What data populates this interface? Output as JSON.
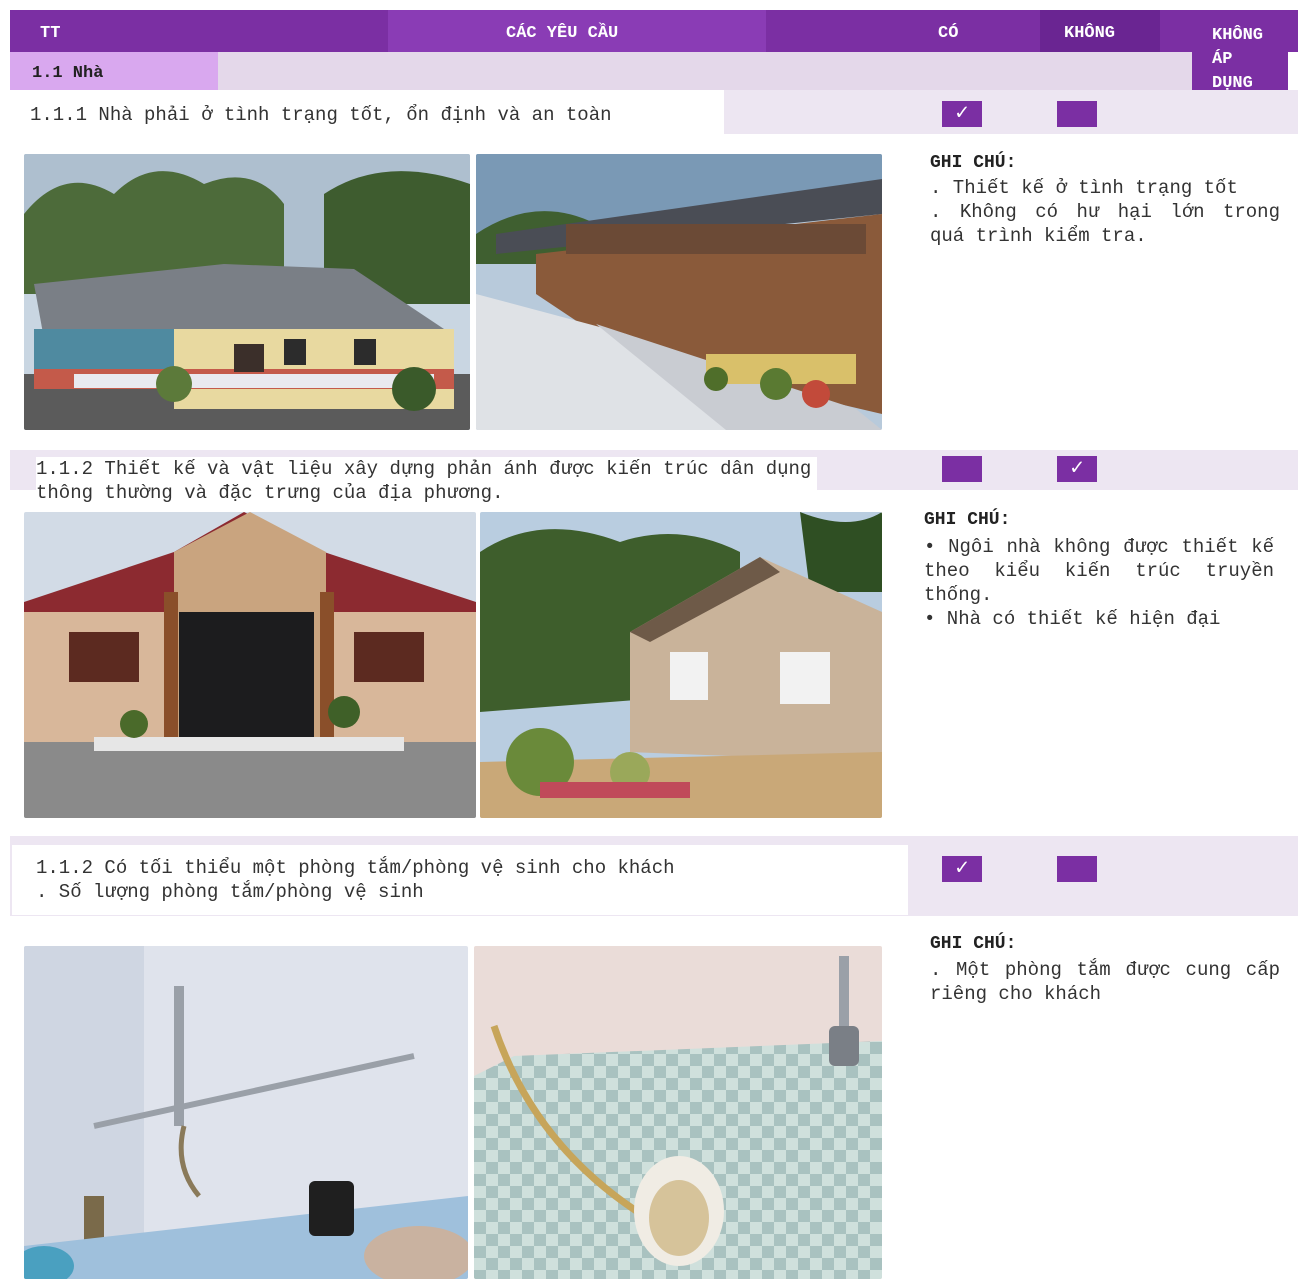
{
  "header": {
    "col_tt": "TT",
    "col_requirements": "CÁC YÊU CẦU",
    "col_yes": "CÓ",
    "col_no": "KHÔNG",
    "col_na": "KHÔNG\nÁP\nDỤNG"
  },
  "section": {
    "title": "1.1 Nhà"
  },
  "items": [
    {
      "title": "1.1.1 Nhà phải ở tình trạng tốt, ổn định và an toàn",
      "yes_mark": "✓",
      "no_mark": "",
      "note_title": "GHI CHÚ:",
      "note_text": ". Thiết kế ở tình trạng tốt\n. Không có hư hại lớn trong quá trình kiểm tra."
    },
    {
      "title": "1.1.2 Thiết kế và vật liệu xây dựng phản ánh được kiến trúc dân dụng\nthông thường và đặc trưng của địa phương.",
      "yes_mark": "",
      "no_mark": "✓",
      "note_title": "GHI CHÚ:",
      "note_text": "• Ngôi nhà không được thiết kế theo kiểu kiến trúc truyền thống.\n• Nhà có thiết kế hiện đại"
    },
    {
      "title": "1.1.2 Có tối thiểu một phòng tắm/phòng vệ sinh cho khách\n. Số lượng phòng tắm/phòng vệ sinh",
      "yes_mark": "✓",
      "no_mark": "",
      "note_title": "GHI CHÚ:",
      "note_text": ". Một phòng tắm được cung cấp riêng cho khách"
    }
  ]
}
